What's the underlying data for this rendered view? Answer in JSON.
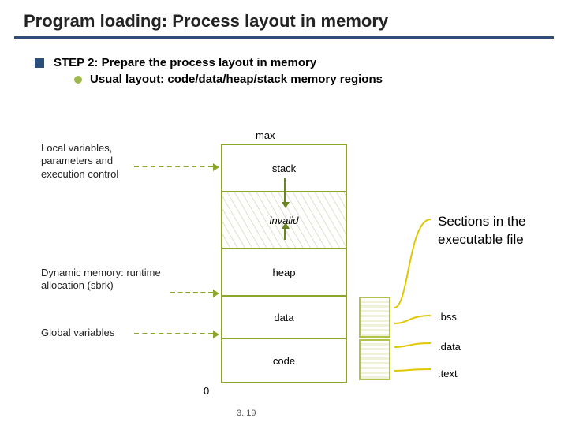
{
  "title": "Program loading: Process layout in memory",
  "bullet_main": "STEP 2: Prepare the process layout in memory",
  "bullet_sub": "Usual layout: code/data/heap/stack memory regions",
  "axis_top": "max",
  "axis_bottom": "0",
  "left": {
    "stack": "Local variables, parameters and execution control",
    "heap": "Dynamic memory: runtime allocation (sbrk)",
    "data": "Global variables"
  },
  "regions": {
    "stack": "stack",
    "invalid": "invalid",
    "heap": "heap",
    "data": "data",
    "code": "code"
  },
  "right": {
    "bss": ".bss",
    "data": ".data",
    "text": ".text",
    "sections": "Sections in the executable file"
  },
  "slide_number": "3. 19"
}
